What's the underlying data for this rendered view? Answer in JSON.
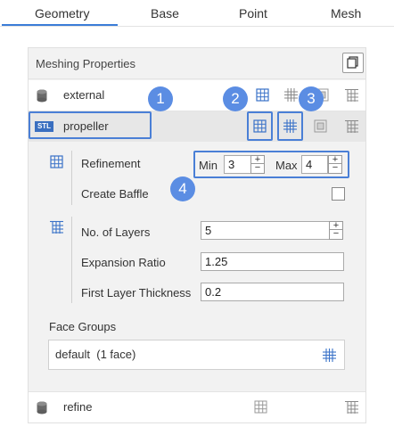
{
  "tabs": [
    "Geometry",
    "Base",
    "Point",
    "Mesh"
  ],
  "panel": {
    "title": "Meshing Properties"
  },
  "rows": {
    "external": "external",
    "propeller": "propeller",
    "refine": "refine"
  },
  "stl_badge": "STL",
  "refinement": {
    "label": "Refinement",
    "min_label": "Min",
    "min_value": "3",
    "max_label": "Max",
    "max_value": "4"
  },
  "baffle": {
    "label": "Create Baffle",
    "checked": false
  },
  "layers": {
    "count_label": "No. of Layers",
    "count_value": "5",
    "ratio_label": "Expansion Ratio",
    "ratio_value": "1.25",
    "thickness_label": "First Layer Thickness",
    "thickness_value": "0.2"
  },
  "face_groups": {
    "label": "Face Groups",
    "item": "default  (1 face)"
  },
  "badges": [
    "1",
    "2",
    "3",
    "4"
  ],
  "colors": {
    "accent": "#3b7dd8",
    "badge": "#5b8de3",
    "highlight": "#4a7fd6",
    "stl": "#3a6fc0"
  },
  "icons": [
    "cylinder-icon",
    "surface-grid-icon",
    "volume-grid-icon",
    "layer-grid-icon",
    "copy-icon"
  ]
}
